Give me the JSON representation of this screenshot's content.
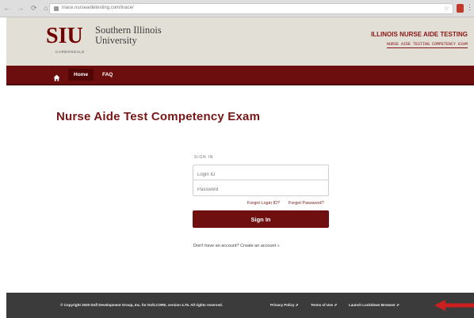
{
  "browser": {
    "url": "inace.nurseaidetesting.com/inace/"
  },
  "header": {
    "logo_siu": "SIU",
    "logo_name": "Southern Illinois University",
    "logo_sub": "CARBONDALE",
    "brand_title": "ILLINOIS NURSE AIDE TESTING",
    "brand_sub": "NURSE AIDE TESTING COMPETENCY EXAM"
  },
  "nav": {
    "items": [
      {
        "label": "Home",
        "active": true
      },
      {
        "label": "FAQ",
        "active": false
      }
    ]
  },
  "main": {
    "title": "Nurse Aide Test Competency Exam",
    "signin_label": "SIGN IN",
    "login_placeholder": "Login ID",
    "password_placeholder": "Password",
    "forgot_login": "Forgot Login ID?",
    "forgot_password": "Forgot Password?",
    "signin_button": "Sign In",
    "create_account": "Don't have an account? Create an account »"
  },
  "footer": {
    "copyright": "© Copyright 2020 Dofl Development Group, Inc. for DofLCORE, version 4.76. All rights reserved.",
    "privacy": "Privacy Policy ⇗",
    "terms": "Terms of Use ⇗",
    "lockdown": "Launch Lockdown Browser ⇗"
  },
  "colors": {
    "brand_maroon": "#6c0d0e",
    "title_red": "#7b1616",
    "header_bg": "#e2dfd6",
    "footer_bg": "#3b3b3b",
    "arrow_red": "#cc1f1f"
  }
}
